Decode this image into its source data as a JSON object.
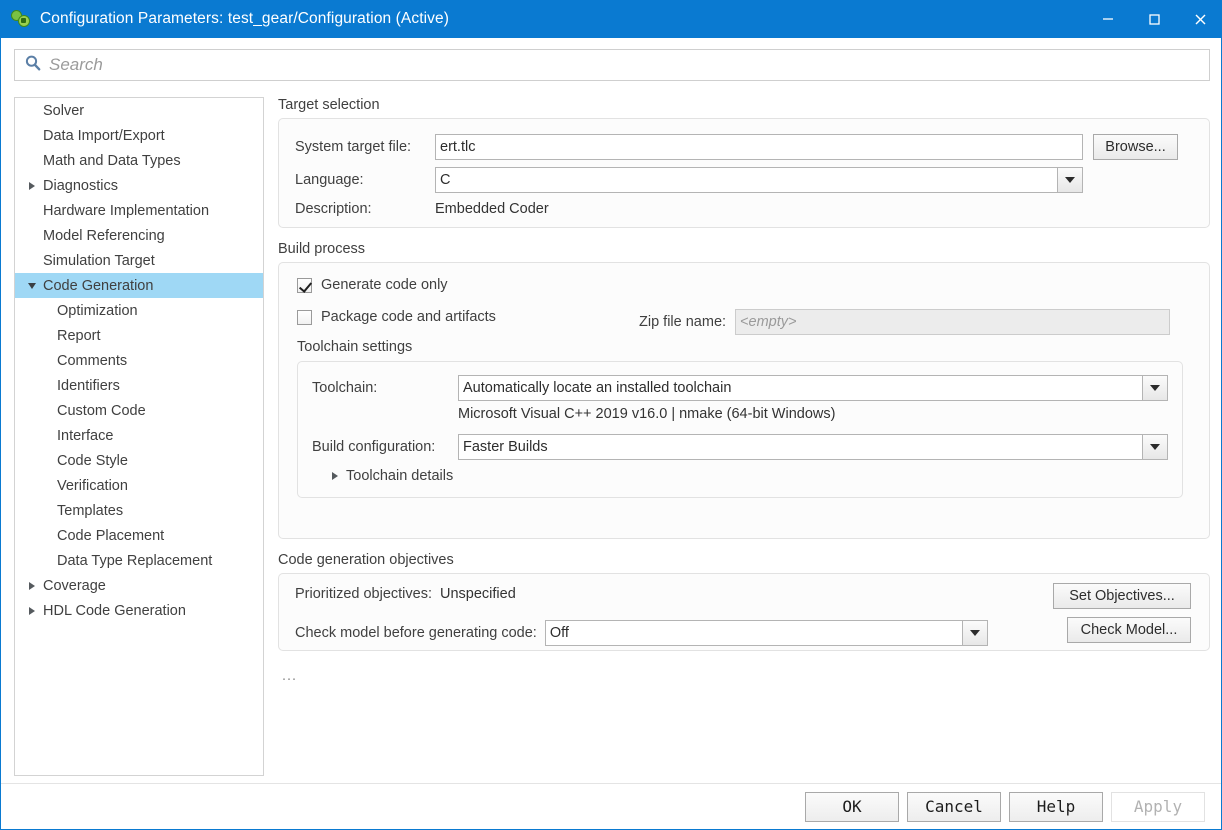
{
  "window": {
    "title": "Configuration Parameters: test_gear/Configuration (Active)",
    "app_icon": "simulink-gear-icon",
    "minimize_icon": "minimize-icon",
    "maximize_icon": "maximize-icon",
    "close_icon": "close-icon",
    "titlebar_color": "#0a7ad1"
  },
  "search": {
    "placeholder": "Search",
    "icon": "search-icon",
    "value": ""
  },
  "tree": {
    "selected": "Code Generation",
    "highlight_color": "#9fd8f5",
    "items": [
      {
        "label": "Solver",
        "level": 0,
        "twisty": "none"
      },
      {
        "label": "Data Import/Export",
        "level": 0,
        "twisty": "none"
      },
      {
        "label": "Math and Data Types",
        "level": 0,
        "twisty": "none"
      },
      {
        "label": "Diagnostics",
        "level": 0,
        "twisty": "collapsed"
      },
      {
        "label": "Hardware Implementation",
        "level": 0,
        "twisty": "none"
      },
      {
        "label": "Model Referencing",
        "level": 0,
        "twisty": "none"
      },
      {
        "label": "Simulation Target",
        "level": 0,
        "twisty": "none"
      },
      {
        "label": "Code Generation",
        "level": 0,
        "twisty": "expanded",
        "selected": true
      },
      {
        "label": "Optimization",
        "level": 1,
        "twisty": "none"
      },
      {
        "label": "Report",
        "level": 1,
        "twisty": "none"
      },
      {
        "label": "Comments",
        "level": 1,
        "twisty": "none"
      },
      {
        "label": "Identifiers",
        "level": 1,
        "twisty": "none"
      },
      {
        "label": "Custom Code",
        "level": 1,
        "twisty": "none"
      },
      {
        "label": "Interface",
        "level": 1,
        "twisty": "none"
      },
      {
        "label": "Code Style",
        "level": 1,
        "twisty": "none"
      },
      {
        "label": "Verification",
        "level": 1,
        "twisty": "none"
      },
      {
        "label": "Templates",
        "level": 1,
        "twisty": "none"
      },
      {
        "label": "Code Placement",
        "level": 1,
        "twisty": "none"
      },
      {
        "label": "Data Type Replacement",
        "level": 1,
        "twisty": "none"
      },
      {
        "label": "Coverage",
        "level": 0,
        "twisty": "collapsed"
      },
      {
        "label": "HDL Code Generation",
        "level": 0,
        "twisty": "collapsed"
      }
    ]
  },
  "target_selection": {
    "group_title": "Target selection",
    "system_target_file_label": "System target file:",
    "system_target_file_value": "ert.tlc",
    "browse_button": "Browse...",
    "language_label": "Language:",
    "language_value": "C",
    "description_label": "Description:",
    "description_value": "Embedded Coder"
  },
  "build_process": {
    "group_title": "Build process",
    "generate_code_only_label": "Generate code only",
    "generate_code_only_checked": true,
    "package_code_label": "Package code and artifacts",
    "package_code_checked": false,
    "zip_file_name_label": "Zip file name:",
    "zip_file_name_placeholder": "<empty>",
    "toolchain_settings_title": "Toolchain settings",
    "toolchain_label": "Toolchain:",
    "toolchain_value": "Automatically locate an installed toolchain",
    "toolchain_info": "Microsoft Visual C++ 2019 v16.0 | nmake (64-bit Windows)",
    "build_configuration_label": "Build configuration:",
    "build_configuration_value": "Faster Builds",
    "toolchain_details_label": "Toolchain details"
  },
  "code_generation_objectives": {
    "group_title": "Code generation objectives",
    "prioritized_objectives_label": "Prioritized objectives:",
    "prioritized_objectives_value": "Unspecified",
    "set_objectives_button": "Set Objectives...",
    "check_model_label": "Check model before generating code:",
    "check_model_value": "Off",
    "check_model_button": "Check Model...",
    "overflow_indicator": "..."
  },
  "footer": {
    "ok": "OK",
    "cancel": "Cancel",
    "help": "Help",
    "apply": "Apply",
    "apply_disabled": true
  }
}
